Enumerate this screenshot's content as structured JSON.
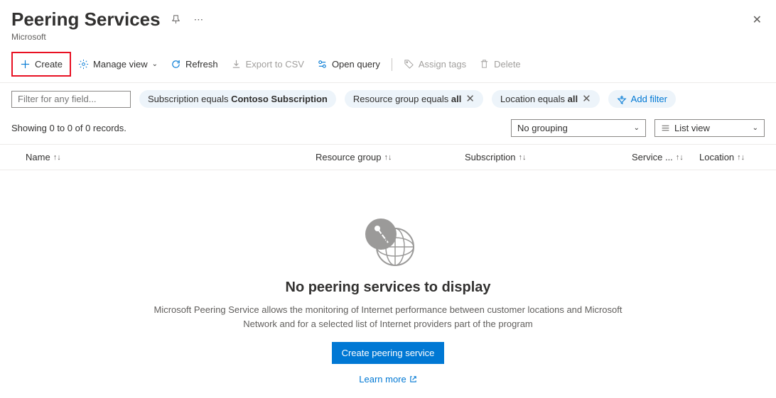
{
  "header": {
    "title": "Peering Services",
    "subtitle": "Microsoft"
  },
  "toolbar": {
    "create": "Create",
    "manageView": "Manage view",
    "refresh": "Refresh",
    "exportCsv": "Export to CSV",
    "openQuery": "Open query",
    "assignTags": "Assign tags",
    "delete": "Delete"
  },
  "filters": {
    "placeholder": "Filter for any field...",
    "pills": [
      {
        "label": "Subscription equals ",
        "value": "Contoso Subscription",
        "closable": false
      },
      {
        "label": "Resource group equals ",
        "value": "all",
        "closable": true
      },
      {
        "label": "Location equals ",
        "value": "all",
        "closable": true
      }
    ],
    "addFilter": "Add filter"
  },
  "status": {
    "records": "Showing 0 to 0 of 0 records.",
    "grouping": "No grouping",
    "view": "List view"
  },
  "columns": {
    "name": "Name",
    "rg": "Resource group",
    "sub": "Subscription",
    "svc": "Service ...",
    "loc": "Location"
  },
  "empty": {
    "title": "No peering services to display",
    "desc": "Microsoft Peering Service allows the monitoring of Internet performance between customer locations and Microsoft Network and for a selected list of Internet providers part of the program",
    "button": "Create peering service",
    "learnMore": "Learn more"
  }
}
